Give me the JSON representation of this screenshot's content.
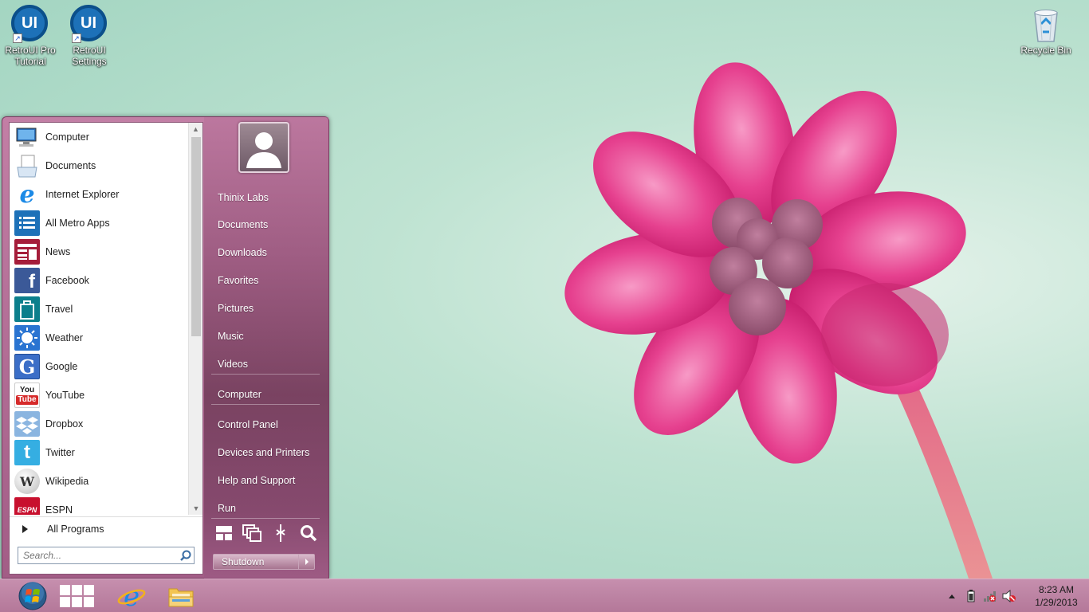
{
  "desktop": {
    "icons": [
      {
        "label": "RetroUI Pro Tutorial",
        "glyph": "UI"
      },
      {
        "label": "RetroUI Settings",
        "glyph": "UI"
      },
      {
        "label": "Recycle Bin"
      }
    ]
  },
  "start_menu": {
    "programs": [
      {
        "label": "Computer",
        "icon": "computer-icon"
      },
      {
        "label": "Documents",
        "icon": "documents-icon"
      },
      {
        "label": "Internet Explorer",
        "icon": "internet-explorer-icon",
        "glyph": "e"
      },
      {
        "label": "All Metro Apps",
        "icon": "metro-apps-icon"
      },
      {
        "label": "News",
        "icon": "news-icon"
      },
      {
        "label": "Facebook",
        "icon": "facebook-icon",
        "glyph": "f"
      },
      {
        "label": "Travel",
        "icon": "travel-icon"
      },
      {
        "label": "Weather",
        "icon": "weather-icon"
      },
      {
        "label": "Google",
        "icon": "google-icon",
        "glyph": "G"
      },
      {
        "label": "YouTube",
        "icon": "youtube-icon",
        "glyph_top": "You",
        "glyph_bottom": "Tube"
      },
      {
        "label": "Dropbox",
        "icon": "dropbox-icon"
      },
      {
        "label": "Twitter",
        "icon": "twitter-icon",
        "glyph": "t"
      },
      {
        "label": "Wikipedia",
        "icon": "wikipedia-icon",
        "glyph": "W"
      },
      {
        "label": "ESPN",
        "icon": "espn-icon",
        "glyph": "ESPN"
      }
    ],
    "all_programs_label": "All Programs",
    "search_placeholder": "Search...",
    "right_items": [
      "Thinix Labs",
      "Documents",
      "Downloads",
      "Favorites",
      "Pictures",
      "Music",
      "Videos",
      "Computer",
      "Control Panel",
      "Devices and Printers",
      "Help and Support",
      "Run"
    ],
    "shutdown_label": "Shutdown"
  },
  "taskbar": {
    "clock_time": "8:23 AM",
    "clock_date": "1/29/2013"
  },
  "colors": {
    "accent": "#b47899",
    "metro_blue": "#1d71b8"
  }
}
